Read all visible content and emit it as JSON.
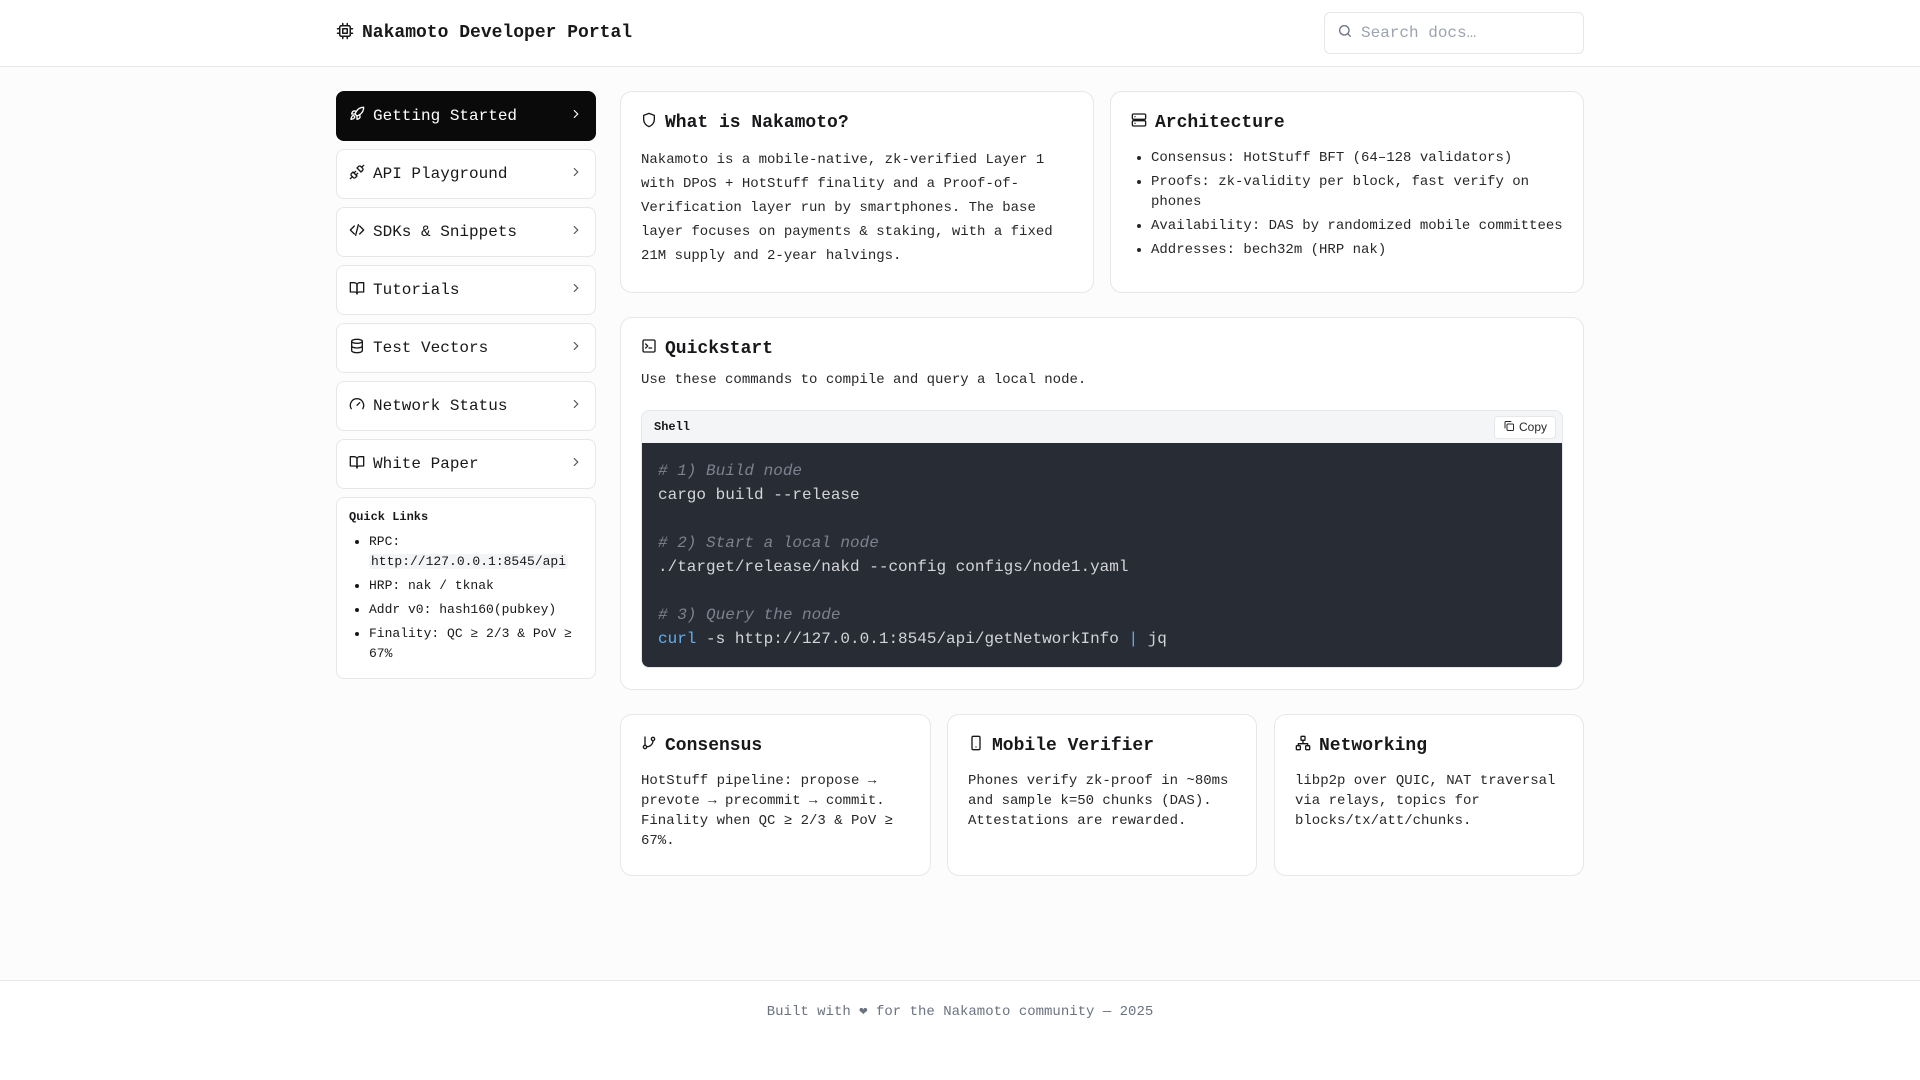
{
  "header": {
    "title": "Nakamoto Developer Portal",
    "search_placeholder": "Search docs…"
  },
  "sidebar": {
    "items": [
      {
        "label": "Getting Started",
        "icon": "rocket-icon",
        "active": true
      },
      {
        "label": "API Playground",
        "icon": "plug-icon",
        "active": false
      },
      {
        "label": "SDKs & Snippets",
        "icon": "code-icon",
        "active": false
      },
      {
        "label": "Tutorials",
        "icon": "book-icon",
        "active": false
      },
      {
        "label": "Test Vectors",
        "icon": "database-icon",
        "active": false
      },
      {
        "label": "Network Status",
        "icon": "gauge-icon",
        "active": false
      },
      {
        "label": "White Paper",
        "icon": "book-open-icon",
        "active": false
      }
    ],
    "quick_links": {
      "title": "Quick Links",
      "rpc_label": "RPC:",
      "rpc_value": "http://127.0.0.1:8545/api",
      "hrp": "HRP: nak / tknak",
      "addr": "Addr v0: hash160(pubkey)",
      "finality": "Finality: QC ≥ 2/3 & PoV ≥ 67%"
    }
  },
  "what_is": {
    "title": "What is Nakamoto?",
    "body": "Nakamoto is a mobile-native, zk-verified Layer 1 with DPoS + HotStuff finality and a Proof-of-Verification layer run by smartphones. The base layer focuses on payments & staking, with a fixed 21M supply and 2-year halvings."
  },
  "architecture": {
    "title": "Architecture",
    "items": [
      "Consensus: HotStuff BFT (64–128 validators)",
      "Proofs: zk-validity per block, fast verify on phones",
      "Availability: DAS by randomized mobile committees",
      "Addresses: bech32m (HRP nak)"
    ]
  },
  "quickstart": {
    "title": "Quickstart",
    "description": "Use these commands to compile and query a local node.",
    "lang": "Shell",
    "copy_label": "Copy",
    "lines": {
      "c1": "# 1) Build node",
      "l1": "cargo build --release",
      "c2": "# 2) Start a local node",
      "l2": "./target/release/nakd --config configs/node1.yaml",
      "c3": "# 3) Query the node",
      "l3_cmd": "curl",
      "l3_args": " -s http://127.0.0.1:8545/api/getNetworkInfo ",
      "l3_pipe": "|",
      "l3_tail": " jq"
    }
  },
  "features": [
    {
      "title": "Consensus",
      "icon": "git-branch-icon",
      "body": "HotStuff pipeline: propose → prevote → precommit → commit. Finality when QC ≥ 2/3 & PoV ≥ 67%."
    },
    {
      "title": "Mobile Verifier",
      "icon": "smartphone-icon",
      "body": "Phones verify zk-proof in ~80ms and sample k=50 chunks (DAS). Attestations are rewarded."
    },
    {
      "title": "Networking",
      "icon": "network-icon",
      "body": "libp2p over QUIC, NAT traversal via relays, topics for blocks/tx/att/chunks."
    }
  ],
  "footer": {
    "text": "Built with ❤ for the Nakamoto community — 2025"
  },
  "colors": {
    "active_nav_bg": "#0a0a0a",
    "code_bg": "#282c34",
    "code_keyword": "#61afef",
    "code_comment": "#7c8290"
  }
}
